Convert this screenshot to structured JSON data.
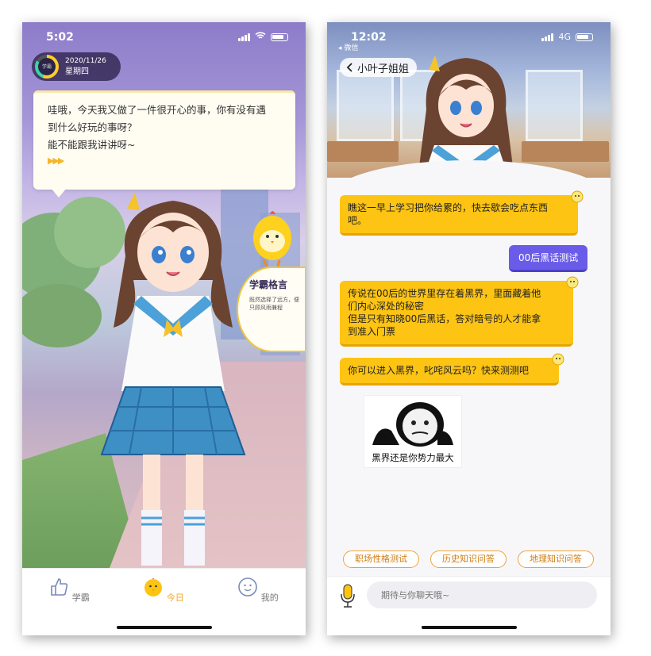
{
  "left_phone": {
    "status": {
      "time": "5:02"
    },
    "date_widget": {
      "date": "2020/11/26",
      "weekday": "星期四",
      "gauge_label": "学霸"
    },
    "speech": {
      "lines": [
        "哇哦，今天我又做了一件很开心的事，你有没有遇",
        "到什么好玩的事呀？",
        "能不能跟我讲讲呀~"
      ]
    },
    "motto": {
      "title": "学霸格言",
      "text": "既然选择了远方，便只顾风雨兼程"
    },
    "tabs": [
      {
        "label": "学霸",
        "icon": "thumbs-up-icon"
      },
      {
        "label": "今日",
        "icon": "chick-mascot-icon"
      },
      {
        "label": "我的",
        "icon": "smiley-icon"
      }
    ],
    "colors": {
      "accent": "#f5a51f",
      "purple": "#8d7cc9"
    }
  },
  "right_phone": {
    "status": {
      "time": "12:02",
      "network": "4G",
      "back_app": "微信"
    },
    "header": {
      "title": "小叶子姐姐",
      "back_icon": "chevron-left-icon"
    },
    "messages": [
      {
        "from": "bot",
        "lines": [
          "瞧这一早上学习把你给累的，快去歇会吃点东西",
          "吧。"
        ]
      },
      {
        "from": "user",
        "text": "00后黑话测试"
      },
      {
        "from": "bot",
        "lines": [
          "传说在00后的世界里存在着黑界，里面藏着他",
          "们内心深处的秘密",
          "但是只有知晓00后黑话，答对暗号的人才能拿",
          "到准入门票"
        ]
      },
      {
        "from": "bot",
        "lines": [
          "你可以进入黑界，叱咤风云吗？快来测测吧"
        ]
      },
      {
        "from": "bot-image",
        "caption": "黑界还是你势力最大"
      }
    ],
    "chips": [
      "职场性格测试",
      "历史知识问答",
      "地理知识问答"
    ],
    "input": {
      "placeholder": "期待与你聊天哦~"
    },
    "colors": {
      "bot_bubble": "#fdc414",
      "user_bubble": "#6a5ce8",
      "chip_border": "#f0a23a"
    }
  }
}
